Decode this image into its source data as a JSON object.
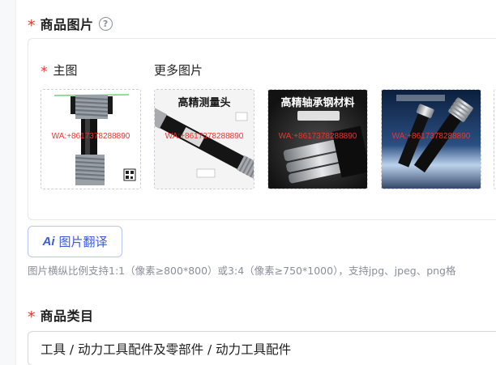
{
  "image_section": {
    "title": "商品图片",
    "required_mark": "*",
    "help_icon": "question-circle-icon",
    "help_glyph": "?",
    "main_image_label": "主图",
    "more_images_label": "更多图片",
    "watermark_text": "WA:+8617378288890",
    "images": [
      {
        "title": "",
        "caption": ""
      },
      {
        "title": "高精测量头",
        "caption": ""
      },
      {
        "title": "高精轴承钢材料",
        "caption": ""
      },
      {
        "title": "",
        "caption": ""
      }
    ]
  },
  "translate_button": {
    "ai_label": "Ai",
    "label": "图片翻译"
  },
  "hint_text": "图片横纵比例支持1:1（像素≥800*800）或3:4（像素≥750*1000），支持jpg、jpeg、png格",
  "category_section": {
    "title": "商品类目",
    "required_mark": "*",
    "value": "工具 / 动力工具配件及零部件 / 动力工具配件"
  },
  "colors": {
    "required": "#e8382c",
    "accent": "#3a5bd9",
    "hint": "#8a8f99",
    "watermark": "#e8382c"
  }
}
